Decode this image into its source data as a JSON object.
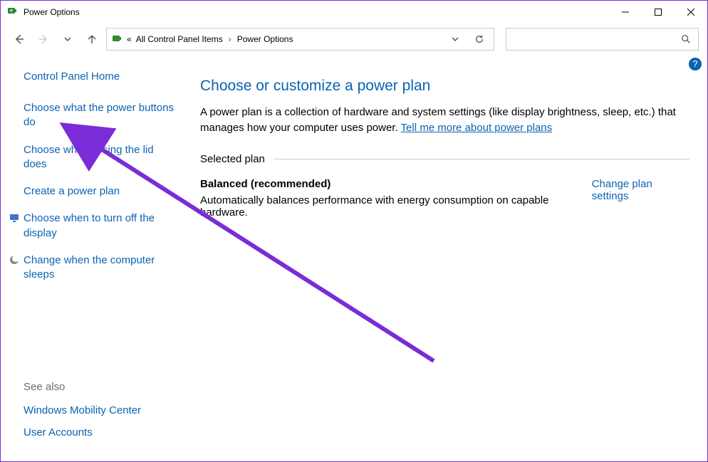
{
  "window": {
    "title": "Power Options"
  },
  "titlebar_controls": {
    "min": "—",
    "max": "☐",
    "close": "✕"
  },
  "breadcrumb": {
    "prefix": "«",
    "items": [
      "All Control Panel Items",
      "Power Options"
    ]
  },
  "help_badge": "?",
  "sidebar": {
    "home": "Control Panel Home",
    "links": [
      {
        "label": "Choose what the power buttons do",
        "icon": null
      },
      {
        "label": "Choose what closing the lid does",
        "icon": null
      },
      {
        "label": "Create a power plan",
        "icon": null
      },
      {
        "label": "Choose when to turn off the display",
        "icon": "monitor-icon"
      },
      {
        "label": "Change when the computer sleeps",
        "icon": "moon-icon"
      }
    ],
    "see_also_label": "See also",
    "see_also": [
      "Windows Mobility Center",
      "User Accounts"
    ]
  },
  "main": {
    "heading": "Choose or customize a power plan",
    "description_pre": "A power plan is a collection of hardware and system settings (like display brightness, sleep, etc.) that manages how your computer uses power. ",
    "description_link": "Tell me more about power plans",
    "selected_plan_label": "Selected plan",
    "plan": {
      "name": "Balanced (recommended)",
      "desc": "Automatically balances performance with energy consumption on capable hardware.",
      "change_link": "Change plan settings"
    }
  },
  "icons": {
    "battery": "battery-icon",
    "back": "back-arrow-icon",
    "forward": "forward-arrow-icon",
    "recent": "chevron-down-icon",
    "up": "up-arrow-icon",
    "dropdown": "chevron-down-icon",
    "refresh": "refresh-icon",
    "search": "search-icon"
  }
}
